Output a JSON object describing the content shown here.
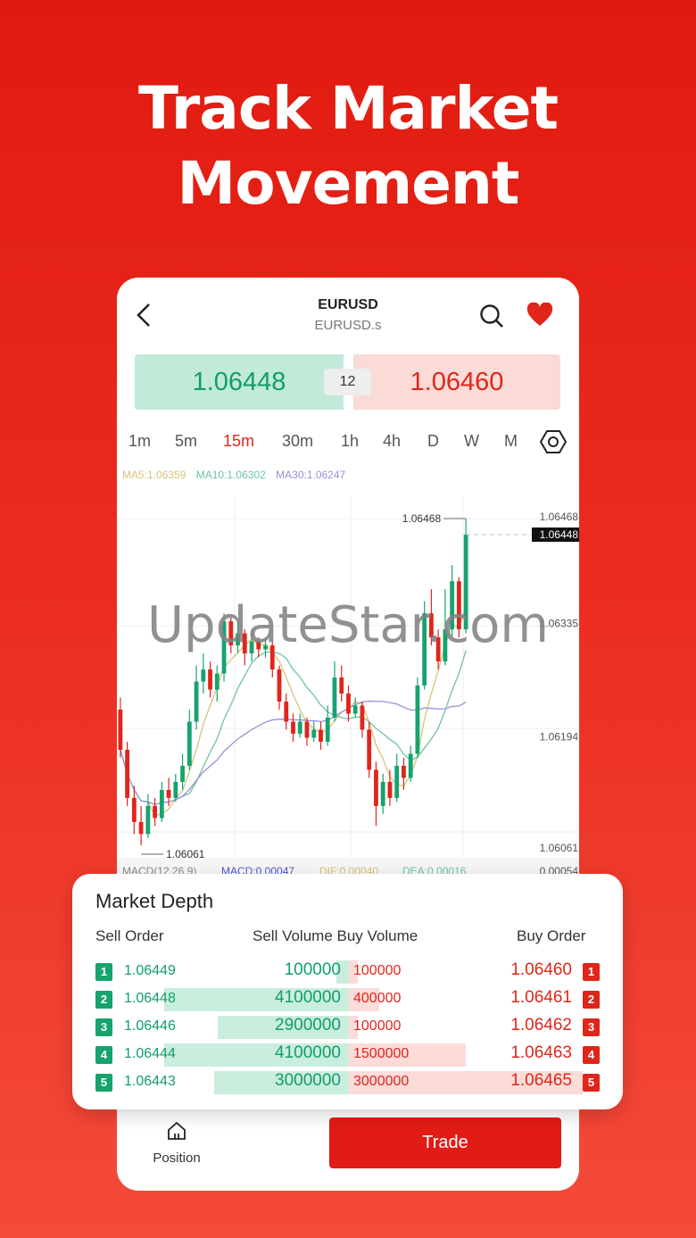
{
  "hero": {
    "line1": "Track Market",
    "line2": "Movement"
  },
  "header": {
    "symbol": "EURUSD",
    "subtitle": "EURUSD.s"
  },
  "quotes": {
    "sell": "1.06448",
    "buy": "1.06460",
    "spread": "12"
  },
  "timeframes": [
    "1m",
    "5m",
    "15m",
    "30m",
    "1h",
    "4h",
    "D",
    "W",
    "M"
  ],
  "active_timeframe": "15m",
  "indicators": {
    "ma5": "MA5:1.06359",
    "ma10": "MA10:1.06302",
    "ma30": "MA30:1.06247",
    "macd": "MACD(12,26,9)",
    "macd_val": "MACD:0.00047",
    "dif": "DIF:0.00040",
    "dea": "DEA:0.00016",
    "macd_axis": "0.00054"
  },
  "colors": {
    "up": "#16a36e",
    "down": "#e0251b",
    "ma5": "#d9c27a",
    "ma10": "#6fc3a0",
    "ma30": "#9a8fd6"
  },
  "chart_data": {
    "type": "candlestick",
    "y_axis_labels": [
      "1.06468",
      "1.06335",
      "1.06194",
      "1.06061"
    ],
    "ylim": [
      1.06061,
      1.06468
    ],
    "current_price_label": "1.06448",
    "high_marker": "1.06468",
    "low_marker": "1.06061",
    "candles": [
      [
        1.0623,
        1.0618,
        1.06245,
        1.0617
      ],
      [
        1.0618,
        1.0612,
        1.0619,
        1.0611
      ],
      [
        1.0612,
        1.0609,
        1.06135,
        1.06075
      ],
      [
        1.0609,
        1.06075,
        1.0611,
        1.06061
      ],
      [
        1.06075,
        1.0611,
        1.06125,
        1.0607
      ],
      [
        1.0611,
        1.06095,
        1.0612,
        1.06085
      ],
      [
        1.06095,
        1.0613,
        1.0614,
        1.0609
      ],
      [
        1.0613,
        1.0612,
        1.06145,
        1.0611
      ],
      [
        1.0612,
        1.0614,
        1.0615,
        1.06115
      ],
      [
        1.0614,
        1.0616,
        1.06175,
        1.0613
      ],
      [
        1.0616,
        1.06215,
        1.0623,
        1.06155
      ],
      [
        1.06215,
        1.06265,
        1.06285,
        1.06205
      ],
      [
        1.06265,
        1.0628,
        1.063,
        1.0625
      ],
      [
        1.0628,
        1.06255,
        1.0629,
        1.06245
      ],
      [
        1.06255,
        1.06275,
        1.06285,
        1.0624
      ],
      [
        1.06275,
        1.0634,
        1.0635,
        1.06265
      ],
      [
        1.0634,
        1.0631,
        1.06345,
        1.063
      ],
      [
        1.0631,
        1.06325,
        1.0634,
        1.063
      ],
      [
        1.06325,
        1.063,
        1.0633,
        1.06285
      ],
      [
        1.063,
        1.06315,
        1.0633,
        1.0629
      ],
      [
        1.06315,
        1.06305,
        1.0632,
        1.06295
      ],
      [
        1.06305,
        1.0631,
        1.0632,
        1.06295
      ],
      [
        1.0631,
        1.0628,
        1.06315,
        1.0627
      ],
      [
        1.0628,
        1.0624,
        1.06285,
        1.0623
      ],
      [
        1.0624,
        1.06215,
        1.0625,
        1.06205
      ],
      [
        1.06215,
        1.062,
        1.06225,
        1.0619
      ],
      [
        1.062,
        1.06215,
        1.06225,
        1.06195
      ],
      [
        1.06215,
        1.06195,
        1.0622,
        1.06185
      ],
      [
        1.06195,
        1.06205,
        1.06215,
        1.0619
      ],
      [
        1.06205,
        1.0619,
        1.06215,
        1.0618
      ],
      [
        1.0619,
        1.0622,
        1.06235,
        1.06185
      ],
      [
        1.0622,
        1.0627,
        1.0629,
        1.06215
      ],
      [
        1.0627,
        1.0625,
        1.06285,
        1.0624
      ],
      [
        1.0625,
        1.06225,
        1.0626,
        1.06215
      ],
      [
        1.06225,
        1.06235,
        1.06245,
        1.0622
      ],
      [
        1.06235,
        1.06205,
        1.0624,
        1.06195
      ],
      [
        1.06205,
        1.06155,
        1.06215,
        1.06145
      ],
      [
        1.06155,
        1.0611,
        1.06165,
        1.06085
      ],
      [
        1.0611,
        1.0614,
        1.0615,
        1.061
      ],
      [
        1.0614,
        1.0612,
        1.06155,
        1.0611
      ],
      [
        1.0612,
        1.0616,
        1.06175,
        1.06115
      ],
      [
        1.0616,
        1.06145,
        1.0617,
        1.0613
      ],
      [
        1.06145,
        1.06175,
        1.06185,
        1.0614
      ],
      [
        1.06175,
        1.0626,
        1.0627,
        1.0617
      ],
      [
        1.0626,
        1.0635,
        1.06365,
        1.06255
      ],
      [
        1.0635,
        1.0632,
        1.0638,
        1.0631
      ],
      [
        1.0632,
        1.0629,
        1.0633,
        1.0628
      ],
      [
        1.0629,
        1.0633,
        1.0638,
        1.06285
      ],
      [
        1.0633,
        1.0639,
        1.0641,
        1.0632
      ],
      [
        1.0639,
        1.0633,
        1.06395,
        1.0632
      ],
      [
        1.0633,
        1.06448,
        1.06468,
        1.06325
      ]
    ]
  },
  "depth": {
    "title": "Market Depth",
    "headers": {
      "sell_order": "Sell Order",
      "volumes": "Sell Volume Buy Volume",
      "buy_order": "Buy Order"
    },
    "rows": [
      {
        "n": "1",
        "sell_price": "1.06449",
        "sell_vol": "100000",
        "buy_vol": "100000",
        "buy_price": "1.06460",
        "sell_frac": 0.03,
        "buy_frac": 0.01
      },
      {
        "n": "2",
        "sell_price": "1.06448",
        "sell_vol": "4100000",
        "buy_vol": "400000",
        "buy_price": "1.06461",
        "sell_frac": 1.0,
        "buy_frac": 0.13
      },
      {
        "n": "3",
        "sell_price": "1.06446",
        "sell_vol": "2900000",
        "buy_vol": "100000",
        "buy_price": "1.06462",
        "sell_frac": 0.71,
        "buy_frac": 0.03
      },
      {
        "n": "4",
        "sell_price": "1.06444",
        "sell_vol": "4100000",
        "buy_vol": "1500000",
        "buy_price": "1.06463",
        "sell_frac": 1.0,
        "buy_frac": 0.5
      },
      {
        "n": "5",
        "sell_price": "1.06443",
        "sell_vol": "3000000",
        "buy_vol": "3000000",
        "buy_price": "1.06465",
        "sell_frac": 0.73,
        "buy_frac": 1.0
      }
    ]
  },
  "bottom": {
    "position_label": "Position",
    "trade_label": "Trade"
  },
  "watermark": "UpdateStar.com"
}
